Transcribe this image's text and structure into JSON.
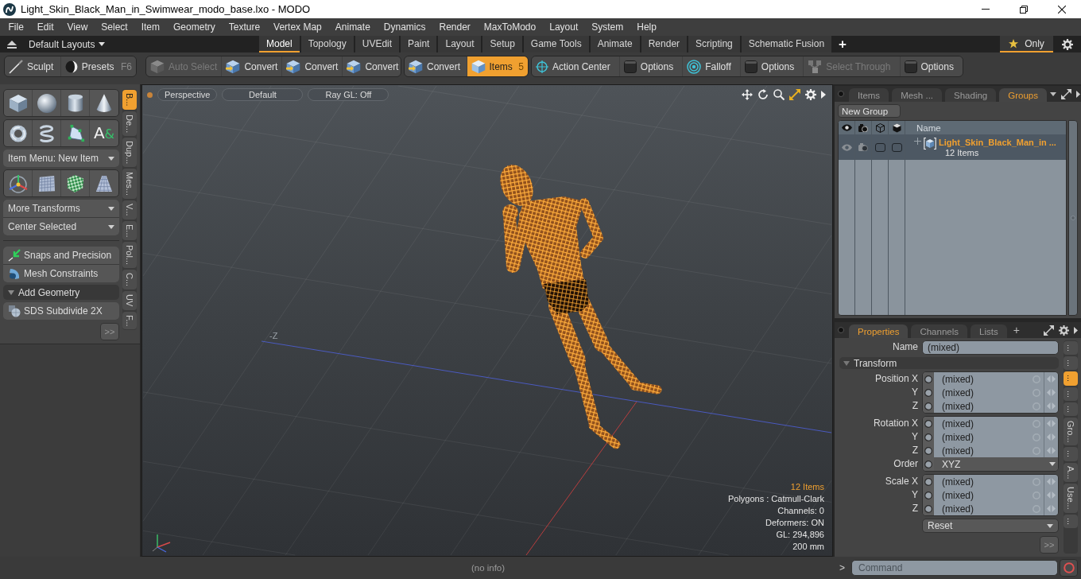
{
  "window": {
    "title": "Light_Skin_Black_Man_in_Swimwear_modo_base.lxo - MODO"
  },
  "menu_bar": [
    "File",
    "Edit",
    "View",
    "Select",
    "Item",
    "Geometry",
    "Texture",
    "Vertex Map",
    "Animate",
    "Dynamics",
    "Render",
    "MaxToModo",
    "Layout",
    "System",
    "Help"
  ],
  "layout_bar": {
    "layouts_menu": "Default Layouts",
    "tabs": [
      {
        "label": "Model",
        "selected": true
      },
      {
        "label": "Topology",
        "selected": false
      },
      {
        "label": "UVEdit",
        "selected": false
      },
      {
        "label": "Paint",
        "selected": false
      },
      {
        "label": "Layout",
        "selected": false
      },
      {
        "label": "Setup",
        "selected": false
      },
      {
        "label": "Game Tools",
        "selected": false
      },
      {
        "label": "Animate",
        "selected": false
      },
      {
        "label": "Render",
        "selected": false
      },
      {
        "label": "Scripting",
        "selected": false
      },
      {
        "label": "Schematic Fusion",
        "selected": false
      }
    ],
    "add_tab": "+",
    "filter": {
      "label": "Only",
      "on": true
    }
  },
  "toolbar": {
    "groups": [
      {
        "items": [
          {
            "kind": "sculpt",
            "label": "Sculpt",
            "selected": false,
            "disabled": false
          },
          {
            "kind": "presets",
            "label": "Presets",
            "shortcut": "F6",
            "selected": false,
            "disabled": false
          }
        ]
      },
      {
        "items": [
          {
            "kind": "auto-select",
            "label": "Auto Select",
            "selected": false,
            "disabled": true
          },
          {
            "kind": "convert",
            "label": "Convert",
            "selected": false,
            "disabled": false
          },
          {
            "kind": "convert",
            "label": "Convert",
            "selected": false,
            "disabled": false
          },
          {
            "kind": "convert",
            "label": "Convert",
            "selected": false,
            "disabled": false
          }
        ]
      },
      {
        "items": [
          {
            "kind": "convert",
            "label": "Convert",
            "selected": false,
            "disabled": false
          },
          {
            "kind": "items",
            "label": "Items",
            "shortcut": "5",
            "selected": true,
            "disabled": false
          }
        ]
      },
      {
        "items": [
          {
            "kind": "action-center",
            "label": "Action Center",
            "selected": false,
            "disabled": false
          },
          {
            "kind": "options",
            "label": "Options",
            "selected": false,
            "disabled": false
          },
          {
            "kind": "falloff",
            "label": "Falloff",
            "selected": false,
            "disabled": false
          },
          {
            "kind": "options",
            "label": "Options",
            "selected": false,
            "disabled": false
          },
          {
            "kind": "select-through",
            "label": "Select Through",
            "selected": false,
            "disabled": true
          },
          {
            "kind": "options",
            "label": "Options",
            "selected": false,
            "disabled": false
          }
        ]
      }
    ]
  },
  "tool_palette": {
    "blocks": [
      {
        "kind": "primitives"
      },
      {
        "kind": "shapes",
        "glyph": "A&"
      },
      {
        "kind": "menu",
        "entries": [
          "Item Menu: New Item"
        ]
      },
      {
        "kind": "transforms"
      },
      {
        "kind": "menu",
        "entries": [
          "More Transforms",
          "Center Selected"
        ]
      },
      {
        "kind": "tools",
        "entries": [
          "Snaps and Precision",
          "Mesh Constraints"
        ]
      },
      {
        "kind": "header",
        "label": "Add Geometry",
        "expanded": true
      },
      {
        "kind": "tools",
        "entries": [
          "SDS Subdivide 2X"
        ]
      }
    ],
    "more": ">>",
    "tabs": [
      {
        "label": "B...",
        "selected": true
      },
      {
        "label": "De...",
        "selected": false
      },
      {
        "label": "Dup...",
        "selected": false
      },
      {
        "label": "Mes...",
        "selected": false
      },
      {
        "label": "V...",
        "selected": false
      },
      {
        "label": "E...",
        "selected": false
      },
      {
        "label": "Pol...",
        "selected": false
      },
      {
        "label": "C...",
        "selected": false
      },
      {
        "label": "UV",
        "selected": false
      },
      {
        "label": "F...",
        "selected": false
      }
    ]
  },
  "viewport": {
    "active": true,
    "header": [
      "Perspective",
      "Default",
      "Ray GL: Off"
    ],
    "axis_label": "-Z",
    "info": [
      {
        "kind": "highlight",
        "text": "12 Items"
      },
      {
        "kind": "plain",
        "text": "Polygons : Catmull-Clark"
      },
      {
        "kind": "plain",
        "text": "Channels: 0"
      },
      {
        "kind": "plain",
        "text": "Deformers: ON"
      },
      {
        "kind": "plain",
        "text": "GL: 294,896"
      },
      {
        "kind": "plain",
        "text": "200 mm"
      }
    ]
  },
  "groups_panel": {
    "tabs": [
      {
        "label": "Items",
        "selected": false
      },
      {
        "label": "Mesh ...",
        "selected": false
      },
      {
        "label": "Shading",
        "selected": false
      },
      {
        "label": "Groups",
        "selected": true
      }
    ],
    "new_group": "New Group",
    "name_column": "Name",
    "rows": [
      {
        "name": "Light_Skin_Black_Man_in ...",
        "count": "12 Items",
        "selected": true,
        "expanded": false,
        "visible": true,
        "render": true,
        "locked": false,
        "selectable": false
      }
    ]
  },
  "properties_panel": {
    "tabs": [
      {
        "label": "Properties",
        "selected": true
      },
      {
        "label": "Channels",
        "selected": false
      },
      {
        "label": "Lists",
        "selected": false
      }
    ],
    "add_tab": "+",
    "name": {
      "label": "Name",
      "value": "(mixed)"
    },
    "section": {
      "label": "Transform",
      "expanded": true
    },
    "transform_groups": [
      [
        {
          "kind": "number",
          "label": "Position X",
          "value": "(mixed)"
        },
        {
          "kind": "number",
          "label": "Y",
          "value": "(mixed)"
        },
        {
          "kind": "number",
          "label": "Z",
          "value": "(mixed)"
        }
      ],
      [
        {
          "kind": "number",
          "label": "Rotation X",
          "value": "(mixed)"
        },
        {
          "kind": "number",
          "label": "Y",
          "value": "(mixed)"
        },
        {
          "kind": "number",
          "label": "Z",
          "value": "(mixed)"
        },
        {
          "kind": "choice",
          "label": "Order",
          "value": "XYZ"
        }
      ],
      [
        {
          "kind": "number",
          "label": "Scale X",
          "value": "(mixed)"
        },
        {
          "kind": "number",
          "label": "Y",
          "value": "(mixed)"
        },
        {
          "kind": "number",
          "label": "Z",
          "value": "(mixed)"
        }
      ]
    ],
    "reset": "Reset",
    "more": ">>",
    "side_tabs": [
      {
        "label": "...",
        "selected": false
      },
      {
        "label": "...",
        "selected": false
      },
      {
        "label": "...",
        "selected": true
      },
      {
        "label": "...",
        "selected": false
      },
      {
        "label": "...",
        "selected": false
      },
      {
        "label": "Gro...",
        "selected": false
      },
      {
        "label": "...",
        "selected": false
      },
      {
        "label": "A...",
        "selected": false
      },
      {
        "label": "Use...",
        "selected": false
      },
      {
        "label": "...",
        "selected": false
      }
    ]
  },
  "status_bar": {
    "message": "(no info)",
    "prompt": ">",
    "command_placeholder": "Command"
  }
}
